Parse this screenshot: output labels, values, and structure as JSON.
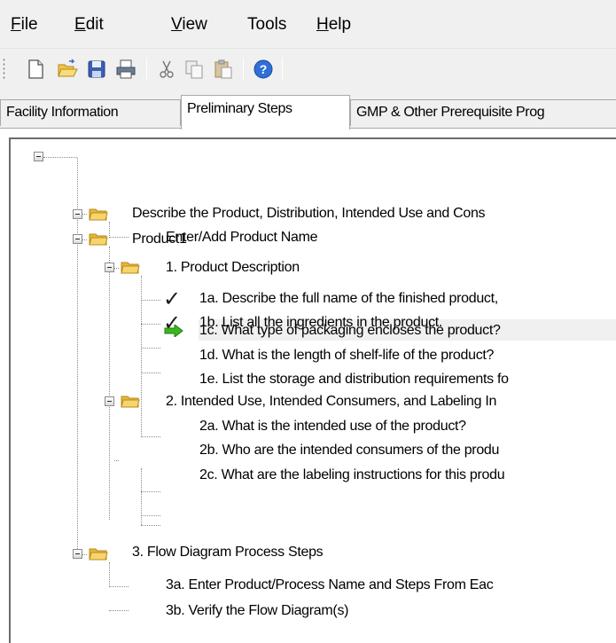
{
  "menu": {
    "file": {
      "accel": "F",
      "rest": "ile"
    },
    "edit": {
      "accel": "E",
      "rest": "dit"
    },
    "view": {
      "accel": "V",
      "rest": "iew"
    },
    "tools": {
      "label": "Tools"
    },
    "help": {
      "accel": "H",
      "rest": "elp"
    }
  },
  "toolbar": {
    "buttons": [
      "new-document-icon",
      "open-folder-icon",
      "save-icon",
      "print-icon",
      "cut-icon",
      "copy-icon",
      "paste-icon",
      "help-icon"
    ]
  },
  "tabs": [
    {
      "label": "Facility Information"
    },
    {
      "label": "Preliminary Steps"
    },
    {
      "label": "GMP & Other Prerequisite Prog"
    }
  ],
  "tree": {
    "root_section": "Describe the Product, Distribution, Intended Use and Cons",
    "enter_product": "Enter/Add Product Name",
    "product": "Product1",
    "product_description": "1. Product Description",
    "step_1a": "1a. Describe the full name of the finished product,",
    "step_1b": "1b. List all the ingredients in the product.",
    "step_1c": "1c. What type of packaging encloses the product?",
    "step_1d": "1d. What is the length of shelf-life of the product?",
    "step_1e": "1e. List the storage and distribution requirements fo",
    "intended_use": "2. Intended Use, Intended Consumers, and Labeling In",
    "step_2a": "2a. What is the intended use of the product?",
    "step_2b": "2b. Who are the intended consumers of the produ",
    "step_2c": "2c. What are the labeling instructions for this produ",
    "flow_diagram": "3. Flow Diagram Process Steps",
    "step_3a": "3a. Enter Product/Process Name and Steps From Eac",
    "step_3b": "3b. Verify the Flow Diagram(s)"
  },
  "colors": {
    "chrome": "#f0f0f0",
    "folder": "#f5c542",
    "arrow": "#3cb521",
    "selected_row": "#f0f0f0"
  }
}
